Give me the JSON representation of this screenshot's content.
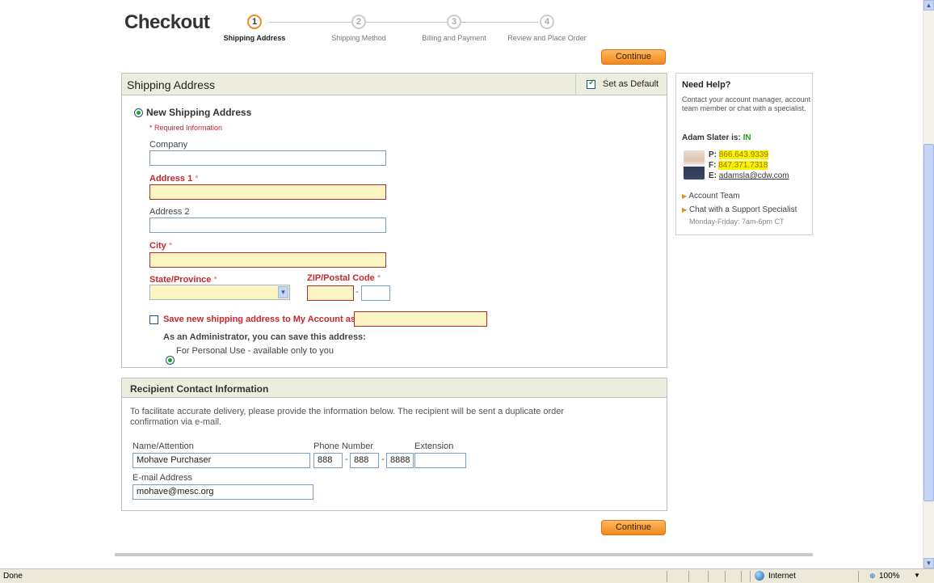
{
  "page": {
    "title": "Checkout"
  },
  "steps": [
    {
      "num": "1",
      "label": "Shipping Address",
      "active": true
    },
    {
      "num": "2",
      "label": "Shipping Method",
      "active": false
    },
    {
      "num": "3",
      "label": "Billing and Payment",
      "active": false
    },
    {
      "num": "4",
      "label": "Review and Place Order",
      "active": false
    }
  ],
  "buttons": {
    "continue_top": "Continue",
    "continue_bottom": "Continue"
  },
  "shipping": {
    "title": "Shipping Address",
    "set_default_label": "Set as Default",
    "set_default_checked": true,
    "new_address_label": "New Shipping Address",
    "required_info": "* Required Information",
    "company_label": "Company",
    "company_value": "",
    "address1_label": "Address 1",
    "address1_value": "",
    "address2_label": "Address 2",
    "address2_value": "",
    "city_label": "City",
    "city_value": "",
    "state_label": "State/Province",
    "state_value": "",
    "zip_label": "ZIP/Postal Code",
    "zip_value": "",
    "zip_ext_value": "",
    "required_star": "*",
    "zip_dash": "-",
    "save_label": "Save new shipping address to My Account as:",
    "save_checked": false,
    "save_value": "",
    "admin_note": "As an Administrator, you can save this address:",
    "personal_use_label": "For Personal Use - available only to you"
  },
  "recipient": {
    "title": "Recipient Contact Information",
    "description": "To facilitate accurate delivery, please provide the information below. The recipient will be sent a duplicate order confirmation via e-mail.",
    "name_label": "Name/Attention",
    "name_value": "Mohave Purchaser",
    "phone_label": "Phone Number",
    "phone_area": "888",
    "phone_prefix": "888",
    "phone_line": "8888",
    "phone_dash": "-",
    "extension_label": "Extension",
    "extension_value": "",
    "email_label": "E-mail Address",
    "email_value": "mohave@mesc.org"
  },
  "help": {
    "title": "Need Help?",
    "text": "Contact your account manager, account team member or chat with a specialist.",
    "manager_prefix": "Adam Slater is: ",
    "manager_status": "IN",
    "phone_label": "P:",
    "phone": "866.643.9339",
    "fax_label": "F:",
    "fax": "847.371.7318",
    "email_label": "E:",
    "email": "adamsla@cdw.com",
    "links": [
      "Account Team",
      "Chat with a Support Specialist"
    ],
    "hours": "Monday-Friday: 7am-6pm CT"
  },
  "statusbar": {
    "left": "Done",
    "zone": "Internet",
    "zoom": "100%"
  },
  "colors": {
    "accent": "#f08a1c",
    "required": "#c2282e",
    "status_in": "#21a121",
    "highlight": "#f5f500"
  }
}
